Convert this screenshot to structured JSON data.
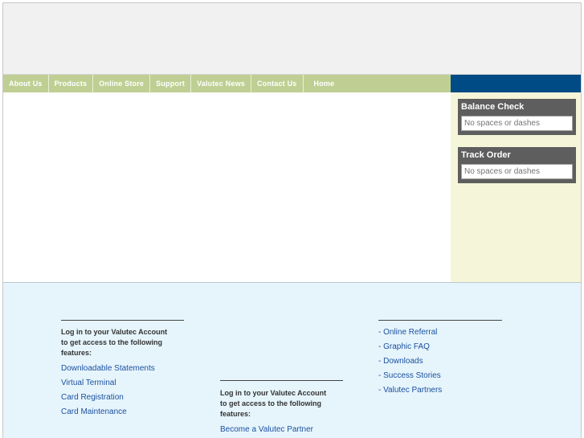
{
  "nav": {
    "items": [
      {
        "label": "About Us"
      },
      {
        "label": "Products"
      },
      {
        "label": "Online Store"
      },
      {
        "label": "Support"
      },
      {
        "label": "Valutec News"
      },
      {
        "label": "Contact Us"
      },
      {
        "label": "Home"
      }
    ]
  },
  "balance_check": {
    "title": "Balance Check",
    "placeholder": "No spaces or dashes"
  },
  "track_order": {
    "title": "Track Order",
    "placeholder": "No spaces or dashes"
  },
  "footer": {
    "col1": {
      "intro_lines": [
        "Log in to your Valutec Account",
        "to get access to the following",
        "features:"
      ],
      "links": [
        "Downloadable Statements",
        "Virtual Terminal",
        "Card Registration",
        "Card Maintenance"
      ]
    },
    "col2": {
      "intro_lines": [
        "Log in to your Valutec Account",
        "to get access to the following",
        "features:"
      ],
      "links": [
        "Become a Valutec Partner"
      ]
    },
    "col3": {
      "links": [
        "- Online Referral",
        "- Graphic FAQ",
        "- Downloads",
        "- Success Stories",
        "- Valutec Partners"
      ]
    }
  },
  "colors": {
    "nav_green": "#bfcf93",
    "nav_blue": "#004a85",
    "panel_bg": "#f5f5d9",
    "footer_bg": "#e6f5fc",
    "link": "#1b4f9e"
  }
}
